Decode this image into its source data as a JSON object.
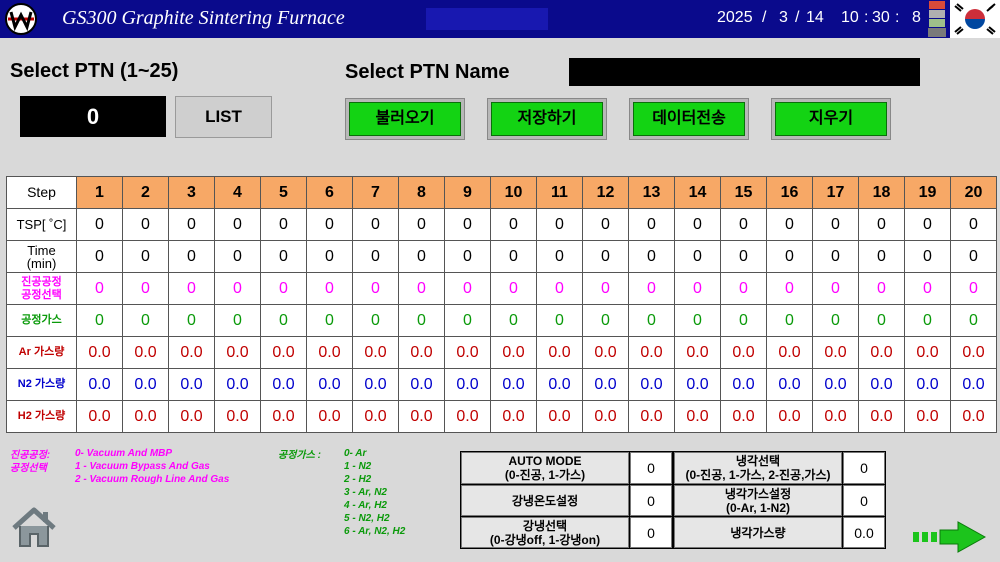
{
  "titlebar": {
    "title": "GS300 Graphite Sintering Furnace",
    "year": "2025",
    "sep1": "/",
    "month": "3",
    "sep2": "/",
    "day": "14",
    "hour": "10",
    "colon1": ":",
    "minute": "30",
    "colon2": ":",
    "second": "8"
  },
  "header": {
    "select_ptn_label": "Select PTN  (1~25)",
    "ptn_value": "0",
    "list_label": "LIST",
    "select_ptn_name_label": "Select PTN Name",
    "buttons": [
      "불러오기",
      "저장하기",
      "데이터전송",
      "지우기"
    ]
  },
  "table": {
    "step_label": "Step",
    "steps": [
      "1",
      "2",
      "3",
      "4",
      "5",
      "6",
      "7",
      "8",
      "9",
      "10",
      "11",
      "12",
      "13",
      "14",
      "15",
      "16",
      "17",
      "18",
      "19",
      "20"
    ],
    "rows": [
      {
        "label": "TSP[ ˚C]",
        "values": [
          "0",
          "0",
          "0",
          "0",
          "0",
          "0",
          "0",
          "0",
          "0",
          "0",
          "0",
          "0",
          "0",
          "0",
          "0",
          "0",
          "0",
          "0",
          "0",
          "0"
        ]
      },
      {
        "label": "Time\n(min)",
        "values": [
          "0",
          "0",
          "0",
          "0",
          "0",
          "0",
          "0",
          "0",
          "0",
          "0",
          "0",
          "0",
          "0",
          "0",
          "0",
          "0",
          "0",
          "0",
          "0",
          "0"
        ]
      },
      {
        "label": "진공공정\n공정선택",
        "values": [
          "0",
          "0",
          "0",
          "0",
          "0",
          "0",
          "0",
          "0",
          "0",
          "0",
          "0",
          "0",
          "0",
          "0",
          "0",
          "0",
          "0",
          "0",
          "0",
          "0"
        ]
      },
      {
        "label": "공정가스",
        "values": [
          "0",
          "0",
          "0",
          "0",
          "0",
          "0",
          "0",
          "0",
          "0",
          "0",
          "0",
          "0",
          "0",
          "0",
          "0",
          "0",
          "0",
          "0",
          "0",
          "0"
        ]
      },
      {
        "label": "Ar 가스량",
        "values": [
          "0.0",
          "0.0",
          "0.0",
          "0.0",
          "0.0",
          "0.0",
          "0.0",
          "0.0",
          "0.0",
          "0.0",
          "0.0",
          "0.0",
          "0.0",
          "0.0",
          "0.0",
          "0.0",
          "0.0",
          "0.0",
          "0.0",
          "0.0"
        ]
      },
      {
        "label": "N2 가스량",
        "values": [
          "0.0",
          "0.0",
          "0.0",
          "0.0",
          "0.0",
          "0.0",
          "0.0",
          "0.0",
          "0.0",
          "0.0",
          "0.0",
          "0.0",
          "0.0",
          "0.0",
          "0.0",
          "0.0",
          "0.0",
          "0.0",
          "0.0",
          "0.0"
        ]
      },
      {
        "label": "H2 가스량",
        "values": [
          "0.0",
          "0.0",
          "0.0",
          "0.0",
          "0.0",
          "0.0",
          "0.0",
          "0.0",
          "0.0",
          "0.0",
          "0.0",
          "0.0",
          "0.0",
          "0.0",
          "0.0",
          "0.0",
          "0.0",
          "0.0",
          "0.0",
          "0.0"
        ]
      }
    ]
  },
  "legend_vacuum": {
    "title_line1": "진공공정:",
    "title_line2": "공정선택",
    "items": [
      "0- Vacuum And MBP",
      "1 - Vacuum Bypass And Gas",
      "2 - Vacuum Rough Line And Gas"
    ]
  },
  "legend_gas": {
    "title": "공정가스 :",
    "items": [
      "0- Ar",
      "1 - N2",
      "2 - H2",
      "3 - Ar, N2",
      "4 - Ar, H2",
      "5 - N2, H2",
      "6 - Ar, N2, H2"
    ]
  },
  "settings": {
    "auto_mode_line1": "AUTO MODE",
    "auto_mode_line2": "(0-진공, 1-가스)",
    "auto_mode_value": "0",
    "cool_select_line1": "냉각선택",
    "cool_select_line2": "(0-진공, 1-가스, 2-진공,가스)",
    "cool_select_value": "0",
    "rapid_temp_label": "강냉온도설정",
    "rapid_temp_value": "0",
    "cool_gas_set_line1": "냉각가스설정",
    "cool_gas_set_line2": "(0-Ar, 1-N2)",
    "cool_gas_set_value": "0",
    "rapid_select_line1": "강냉선택",
    "rapid_select_line2": "(0-강냉off, 1-강냉on)",
    "rapid_select_value": "0",
    "cool_gas_amount_label": "냉각가스량",
    "cool_gas_amount_value": "0.0"
  },
  "colors": {
    "titlebar": "#0a0a8c",
    "step_header": "#f7a866",
    "action_button": "#13d313"
  }
}
